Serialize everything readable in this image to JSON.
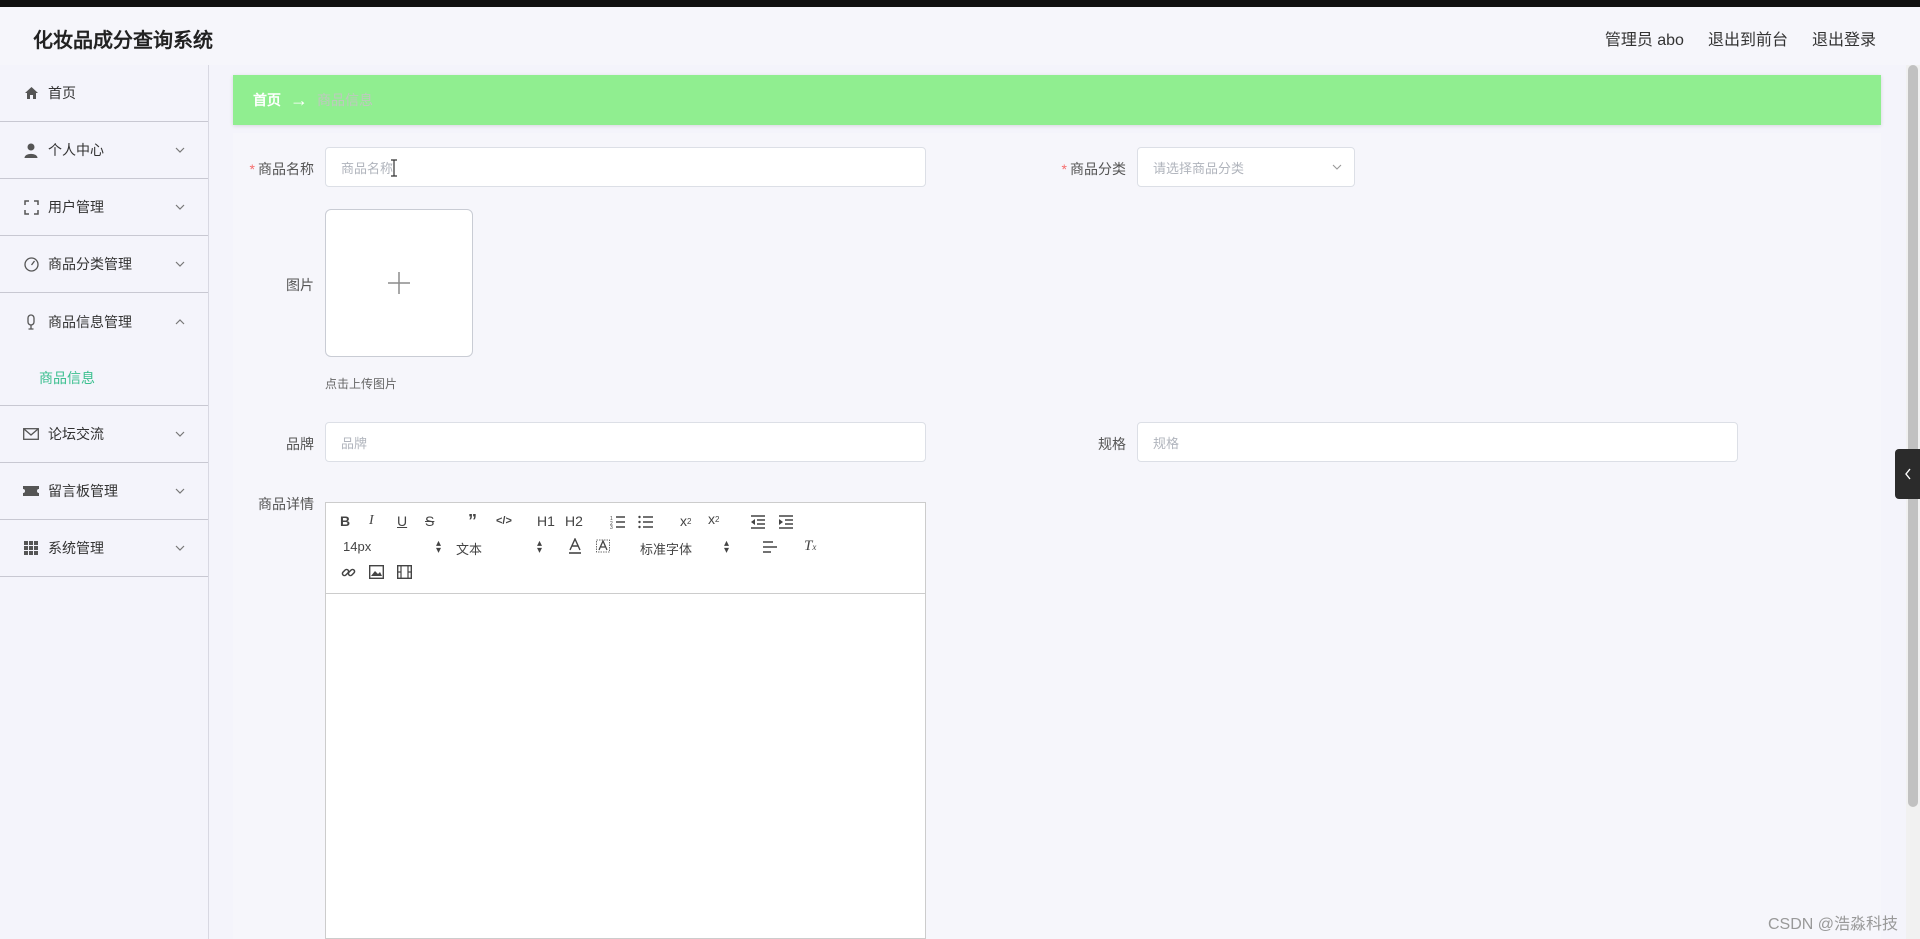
{
  "app": {
    "title": "化妆品成分查询系统"
  },
  "header": {
    "admin": "管理员 abo",
    "to_front": "退出到前台",
    "logout": "退出登录"
  },
  "sidebar": {
    "items": [
      {
        "label": "首页",
        "icon": "home-icon"
      },
      {
        "label": "个人中心",
        "icon": "user-icon"
      },
      {
        "label": "用户管理",
        "icon": "fullscreen-icon"
      },
      {
        "label": "商品分类管理",
        "icon": "gauge-icon"
      },
      {
        "label": "商品信息管理",
        "icon": "mic-icon",
        "expanded": true,
        "sub": [
          "商品信息"
        ]
      },
      {
        "label": "论坛交流",
        "icon": "mail-icon"
      },
      {
        "label": "留言板管理",
        "icon": "ticket-icon"
      },
      {
        "label": "系统管理",
        "icon": "grid-icon"
      }
    ]
  },
  "breadcrumb": {
    "home": "首页",
    "arrow": "→",
    "current": "商品信息"
  },
  "form": {
    "name_label": "商品名称",
    "name_placeholder": "商品名称",
    "category_label": "商品分类",
    "category_placeholder": "请选择商品分类",
    "image_label": "图片",
    "upload_hint": "点击上传图片",
    "brand_label": "品牌",
    "brand_placeholder": "品牌",
    "spec_label": "规格",
    "spec_placeholder": "规格",
    "detail_label": "商品详情"
  },
  "editor": {
    "font_size": "14px",
    "header": "文本",
    "font_family": "标准字体",
    "h1": "H1",
    "h2": "H2"
  },
  "colors": {
    "accent": "#90ee90",
    "active_menu": "#3bbf8f",
    "required": "#f56c6c"
  },
  "watermark": "CSDN @浩淼科技"
}
